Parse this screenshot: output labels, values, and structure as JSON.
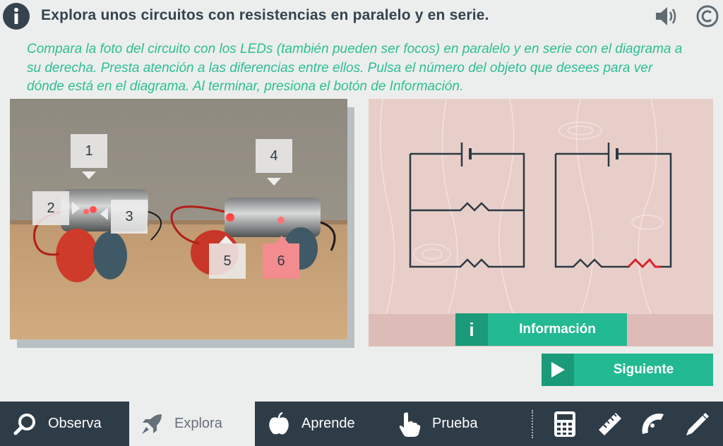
{
  "header": {
    "title": "Explora unos circuitos con resistencias en paralelo y en serie.",
    "icons": [
      "info-icon",
      "speaker-icon",
      "copyright-icon"
    ]
  },
  "instructions": "Compara la foto del circuito con los LEDs (también pueden ser focos) en paralelo y en serie con el diagrama a su derecha. Presta atención a las diferencias entre ellos. Pulsa el número del objeto que desees para ver dónde está en el diagrama. Al terminar, presiona el botón de Información.",
  "photo": {
    "markers": [
      {
        "label": "1",
        "active": false
      },
      {
        "label": "2",
        "active": false
      },
      {
        "label": "3",
        "active": false
      },
      {
        "label": "4",
        "active": false
      },
      {
        "label": "5",
        "active": false
      },
      {
        "label": "6",
        "active": true
      }
    ]
  },
  "buttons": {
    "info_label": "Información",
    "info_icon_glyph": "i",
    "next_label": "Siguiente"
  },
  "nav": {
    "items": [
      {
        "label": "Observa",
        "icon": "magnifier-icon",
        "active": false
      },
      {
        "label": "Explora",
        "icon": "rocket-icon",
        "active": true
      },
      {
        "label": "Aprende",
        "icon": "apple-icon",
        "active": false
      },
      {
        "label": "Prueba",
        "icon": "hand-pointer-icon",
        "active": false
      }
    ],
    "tools": [
      "calculator-icon",
      "ruler-icon",
      "protractor-icon",
      "pencil-icon"
    ]
  },
  "colors": {
    "accent": "#23b992",
    "accent_dark": "#1a9a79",
    "instructions": "#2cbf93",
    "nav_bg": "#2e3c48",
    "highlight": "#f38c8e",
    "resistor_highlight": "#d8232a"
  }
}
